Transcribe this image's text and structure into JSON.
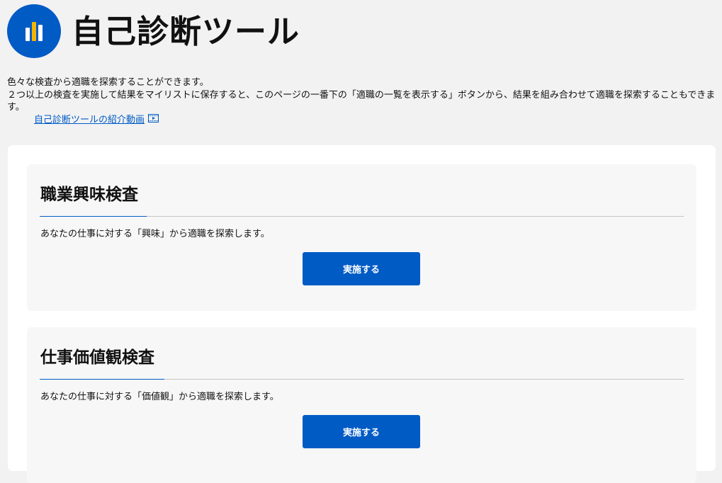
{
  "header": {
    "title": "自己診断ツール",
    "logo_icon": "bar-chart-icon",
    "brand_color": "#005bc5",
    "bar_colors": [
      "#ffffff",
      "#f5b400",
      "#ffffff"
    ]
  },
  "intro": {
    "line1": "色々な検査から適職を探索することができます。",
    "line2": "２つ以上の検査を実施して結果をマイリストに保存すると、このページの一番下の「適職の一覧を表示する」ボタンから、結果を組み合わせて適職を探索することもできます。",
    "video_link": "自己診断ツールの紹介動画",
    "video_icon": "video-play-icon"
  },
  "cards": [
    {
      "title": "職業興味検査",
      "description": "あなたの仕事に対する「興味」から適職を探索します。",
      "button_label": "実施する"
    },
    {
      "title": "仕事価値観検査",
      "description": "あなたの仕事に対する「価値観」から適職を探索します。",
      "button_label": "実施する"
    }
  ]
}
